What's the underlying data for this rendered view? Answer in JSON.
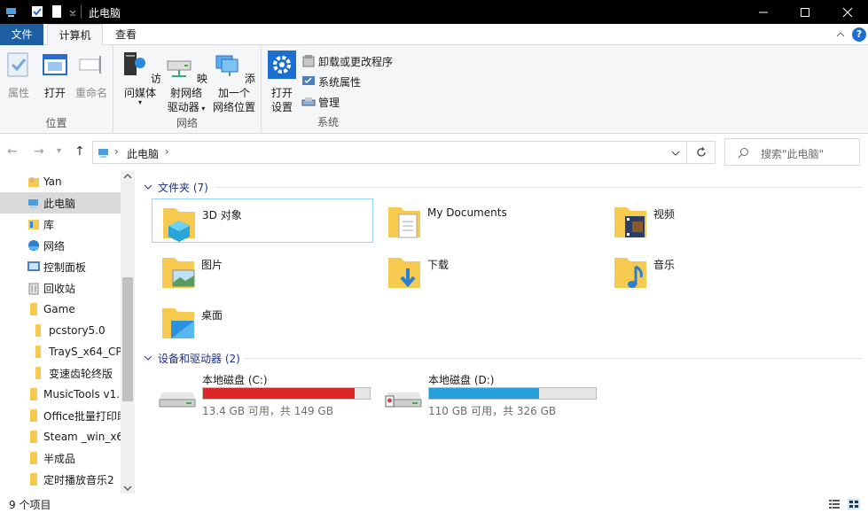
{
  "window": {
    "title": "此电脑"
  },
  "ribbon_tabs": {
    "file": "文件",
    "computer": "计算机",
    "view": "查看"
  },
  "ribbon": {
    "location_group": {
      "label": "位置",
      "properties": "属性",
      "open": "打开",
      "rename": "重命名"
    },
    "network_group": {
      "label": "网络",
      "access_media": "访问媒体",
      "map_drive_line1": "映射网络",
      "map_drive_line2": "驱动器",
      "add_location_line1": "添加一个",
      "add_location_line2": "网络位置"
    },
    "system_group": {
      "label": "系统",
      "open_settings_line1": "打开",
      "open_settings_line2": "设置",
      "uninstall": "卸载或更改程序",
      "system_properties": "系统属性",
      "manage": "管理"
    }
  },
  "address": {
    "path": "此电脑",
    "search_placeholder": "搜索\"此电脑\""
  },
  "nav": {
    "items": [
      {
        "label": "Yan"
      },
      {
        "label": "此电脑"
      },
      {
        "label": "库"
      },
      {
        "label": "网络"
      },
      {
        "label": "控制面板"
      },
      {
        "label": "回收站"
      },
      {
        "label": "Game"
      },
      {
        "label": "pcstory5.0"
      },
      {
        "label": "TrayS_x64_CP"
      },
      {
        "label": "变速齿轮终版"
      },
      {
        "label": "MusicTools v1."
      },
      {
        "label": "Office批量打印助"
      },
      {
        "label": "Steam _win_x6"
      },
      {
        "label": "半成品"
      },
      {
        "label": "定时播放音乐2"
      }
    ]
  },
  "folders": {
    "header": "文件夹 (7)",
    "items": [
      {
        "label": "3D 对象",
        "icon": "3d-objects-folder-icon"
      },
      {
        "label": "My Documents",
        "icon": "documents-folder-icon"
      },
      {
        "label": "视频",
        "icon": "videos-folder-icon"
      },
      {
        "label": "图片",
        "icon": "pictures-folder-icon"
      },
      {
        "label": "下载",
        "icon": "downloads-folder-icon"
      },
      {
        "label": "音乐",
        "icon": "music-folder-icon"
      },
      {
        "label": "桌面",
        "icon": "desktop-folder-icon"
      }
    ]
  },
  "devices": {
    "header": "设备和驱动器 (2)",
    "drives": [
      {
        "name": "本地磁盘 (C:)",
        "space": "13.4 GB 可用，共 149 GB",
        "used_fraction": 0.91,
        "color": "#da2626"
      },
      {
        "name": "本地磁盘 (D:)",
        "space": "110 GB 可用，共 326 GB",
        "used_fraction": 0.66,
        "color": "#26a0da"
      }
    ]
  },
  "status": {
    "item_count": "9 个项目"
  },
  "colors": {
    "accent": "#1e5fa3",
    "nav_selected": "#d9d9d9",
    "section_header": "#1e3287",
    "folder_yellow": "#f6c94f"
  }
}
